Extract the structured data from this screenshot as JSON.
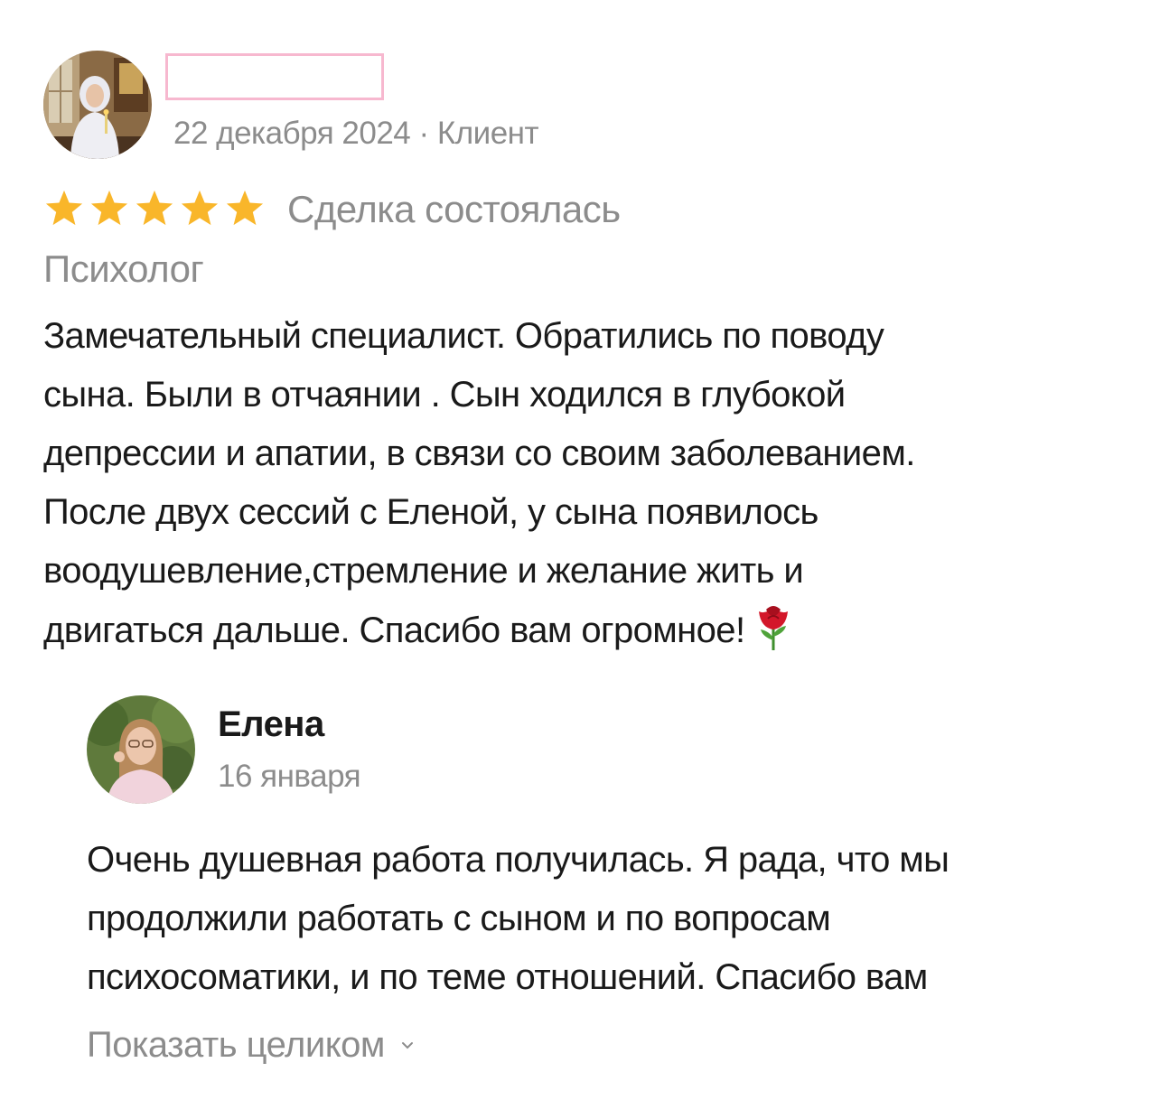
{
  "review": {
    "date": "22 декабря 2024",
    "separator": " · ",
    "author_role": "Клиент",
    "rating": 5,
    "rating_max": 5,
    "deal_status": "Сделка состоялась",
    "service_category": "Психолог",
    "text_lines": [
      "Замечательный специалист. Обратились по поводу",
      "сына. Были в отчаянии . Сын ходился в глубокой",
      "депрессии и апатии, в связи со своим заболеванием.",
      "После двух сессий с Еленой, у сына появилось",
      "воодушевление,стремление и желание жить и",
      "двигаться дальше. Спасибо вам огромное!"
    ],
    "emoji": "rose-icon"
  },
  "reply": {
    "author": "Елена",
    "date": "16 января",
    "text_lines": [
      "Очень душевная работа получилась. Я рада, что мы",
      "продолжили работать с сыном и по вопросам",
      "психосоматики, и по теме отношений. Спасибо вам"
    ],
    "show_full_label": "Показать целиком"
  },
  "colors": {
    "star": "#f9b62a",
    "secondary_text": "#8c8c8c",
    "primary_text": "#1a1a1a",
    "redaction_border": "#f7b8cf"
  }
}
